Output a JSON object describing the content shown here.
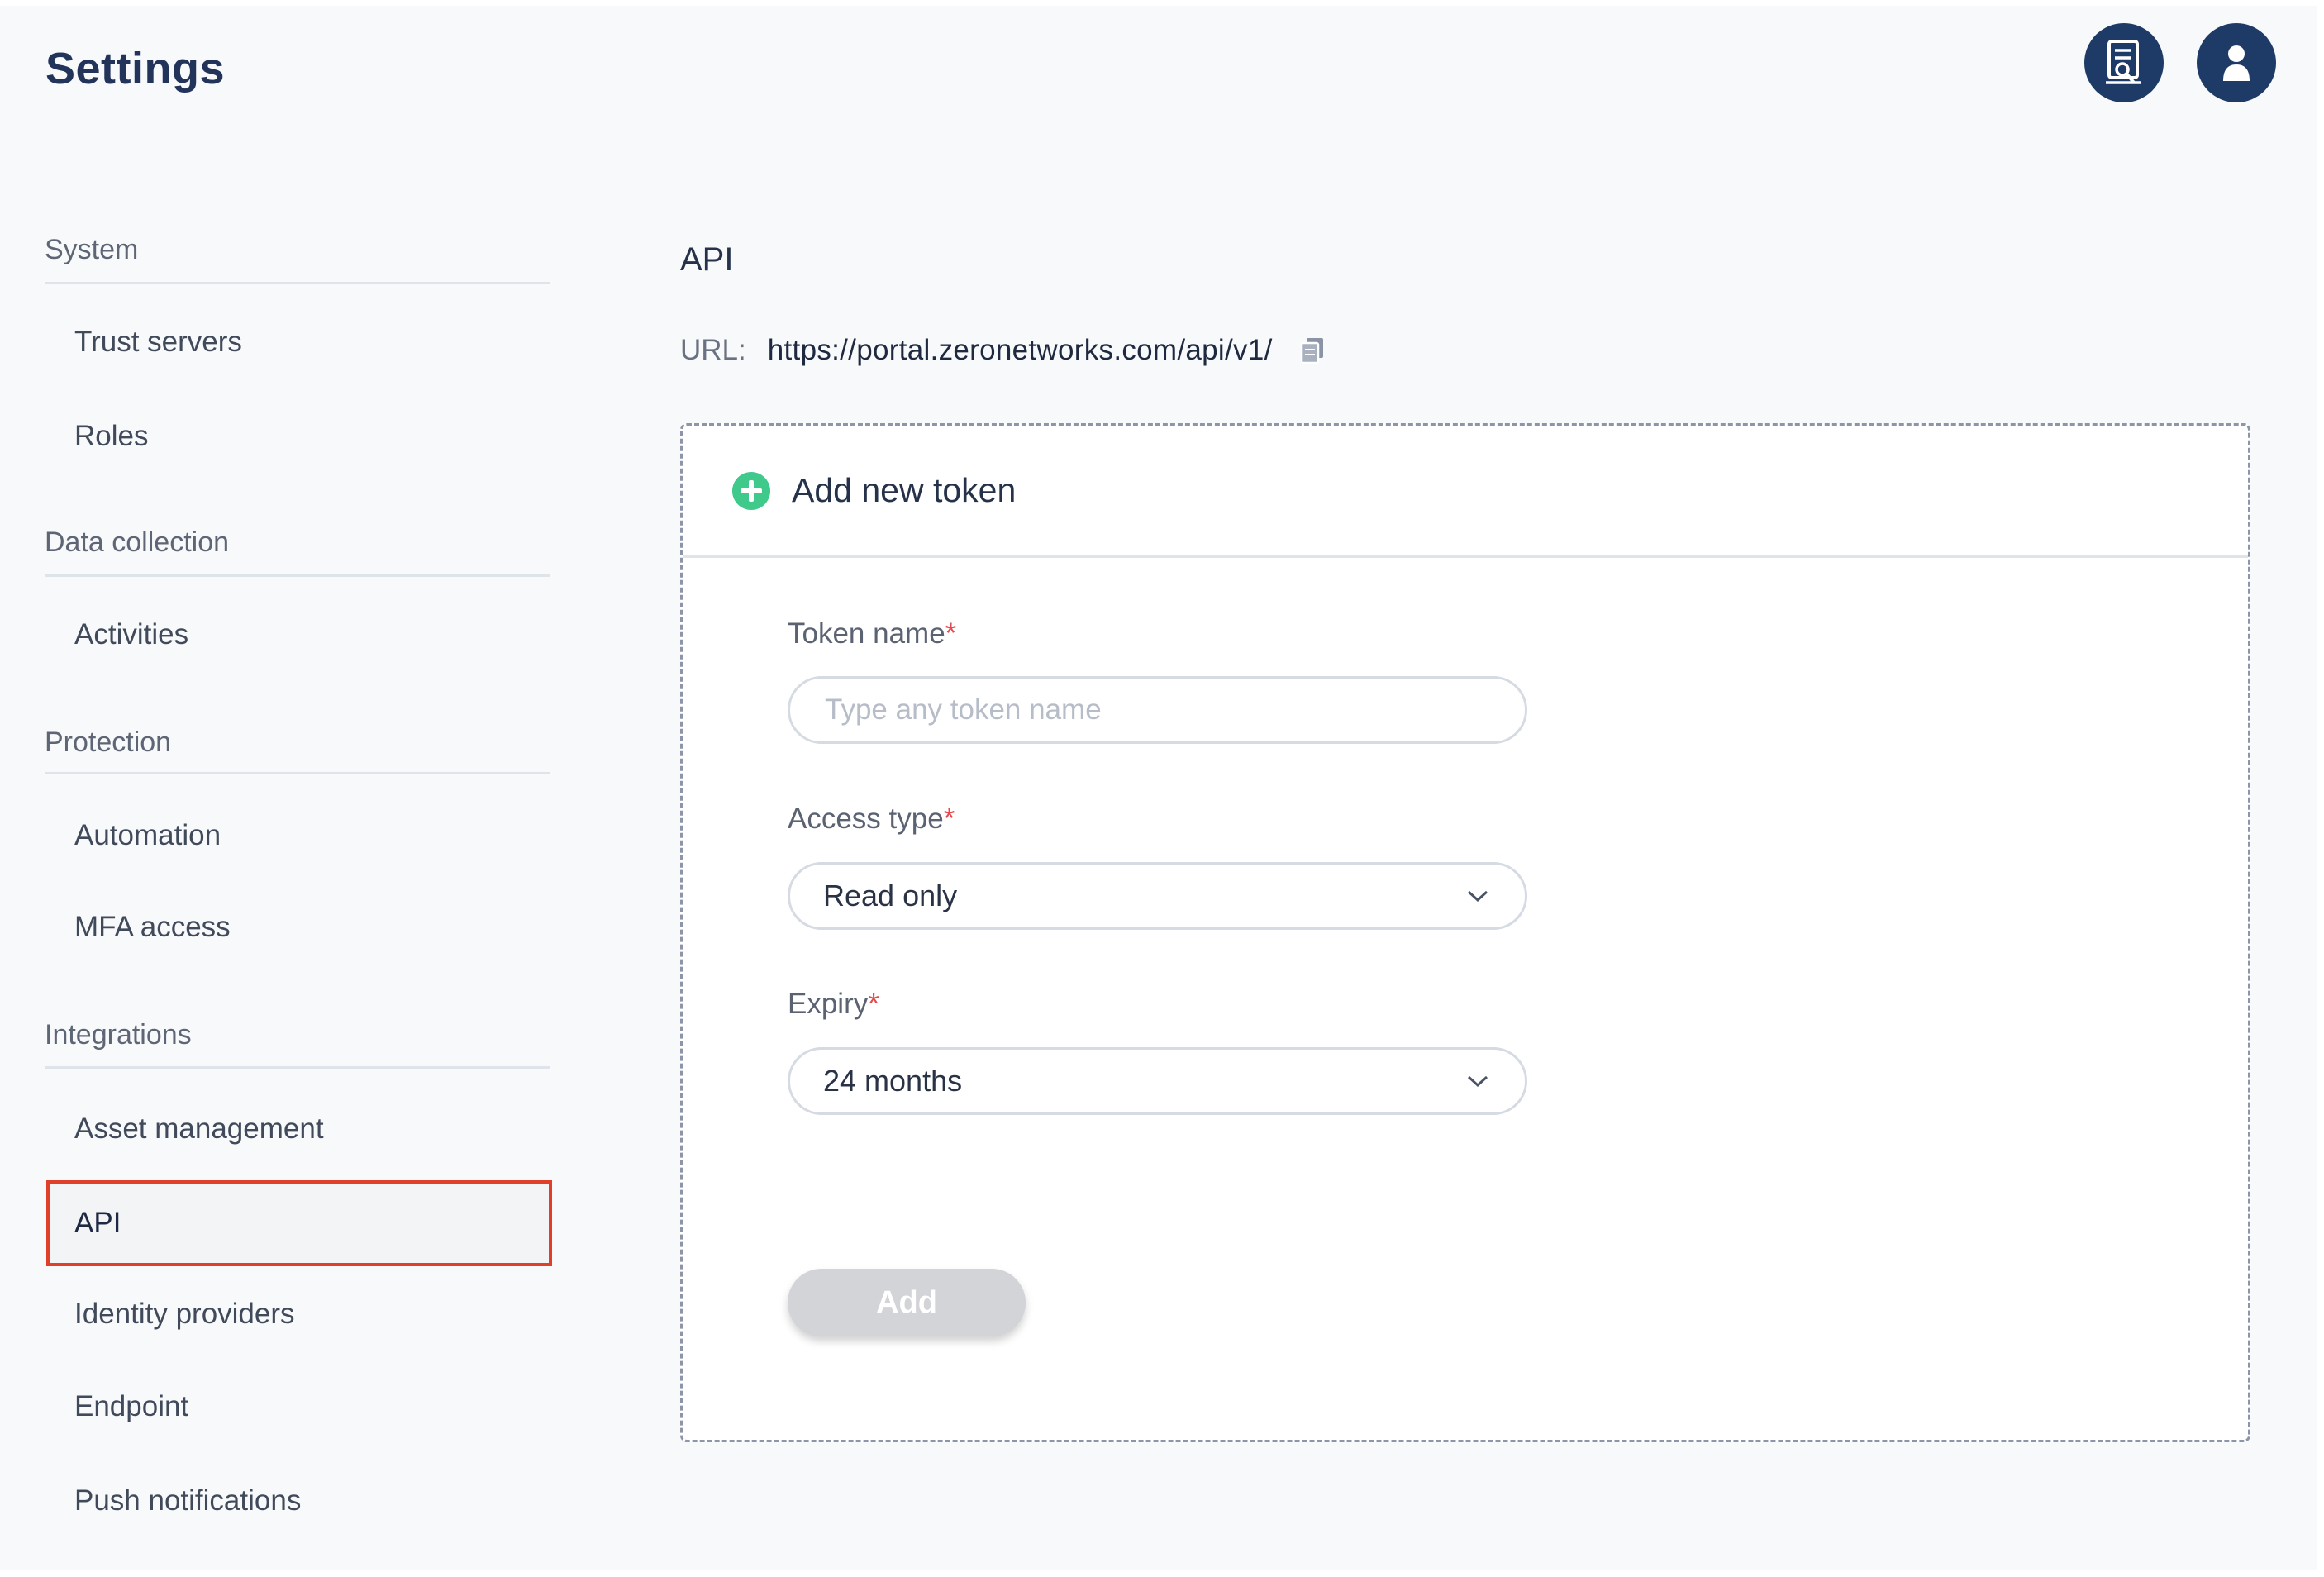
{
  "header": {
    "title": "Settings",
    "docs_icon": "api-docs-icon",
    "user_icon": "user-icon"
  },
  "sidebar": {
    "groups": [
      {
        "label": "System",
        "items": [
          "Trust servers",
          "Roles"
        ]
      },
      {
        "label": "Data collection",
        "items": [
          "Activities"
        ]
      },
      {
        "label": "Protection",
        "items": [
          "Automation",
          "MFA access"
        ]
      },
      {
        "label": "Integrations",
        "items": [
          "Asset management",
          "API",
          "Identity providers",
          "Endpoint",
          "Push notifications"
        ]
      }
    ],
    "selected": "API"
  },
  "content": {
    "section_title": "API",
    "url_label": "URL:",
    "url_value": "https://portal.zeronetworks.com/api/v1/",
    "copy_icon": "copy-icon",
    "card": {
      "header": "Add new token",
      "token_name_label": "Token name",
      "token_name_placeholder": "Type any token name",
      "token_name_value": "",
      "access_type_label": "Access type",
      "access_type_value": "Read only",
      "expiry_label": "Expiry",
      "expiry_value": "24 months",
      "required_marker": "*",
      "add_label": "Add"
    }
  },
  "colors": {
    "brand_navy": "#1d3b66",
    "selection_outline": "#e0402a",
    "add_icon_green": "#3fc98a",
    "required_red": "#e5484d",
    "disabled_button": "#d2d4d8"
  }
}
